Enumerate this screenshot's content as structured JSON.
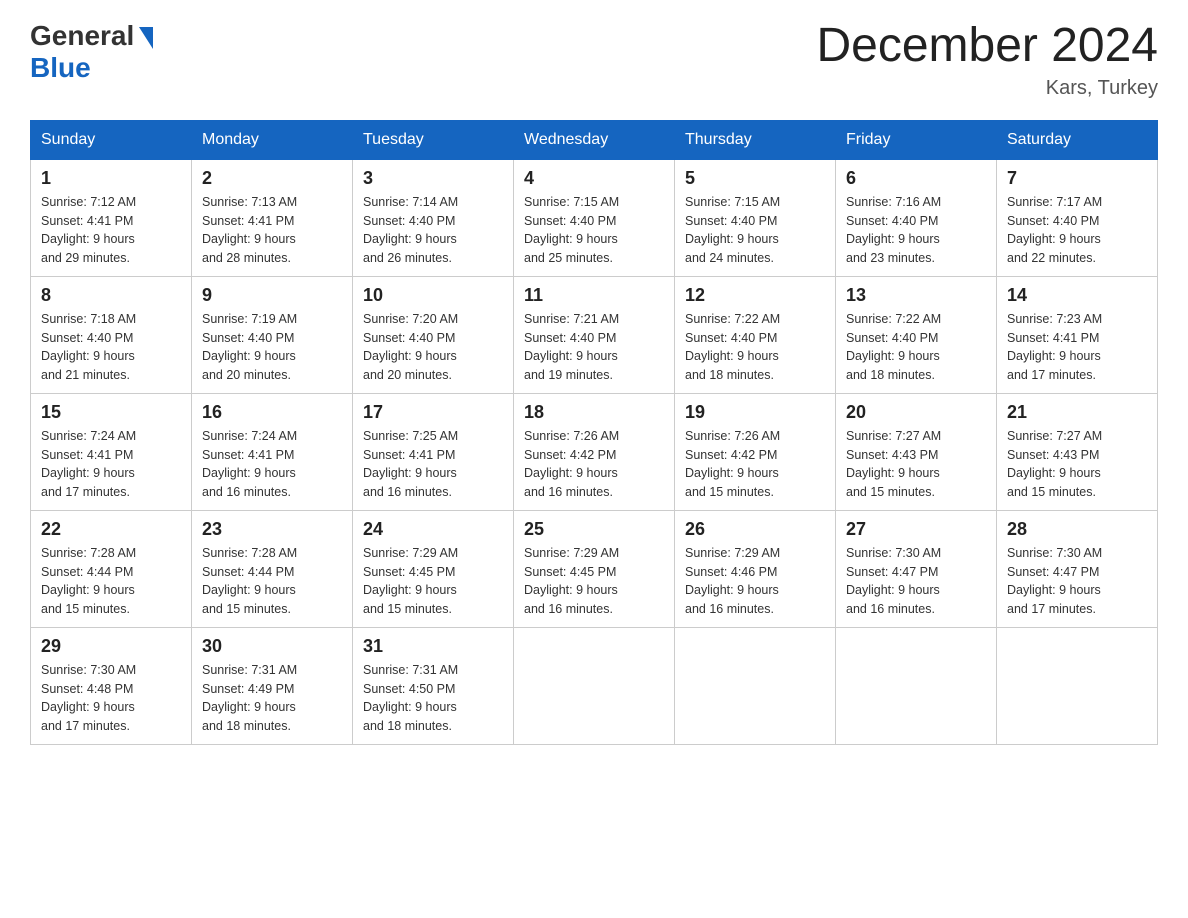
{
  "header": {
    "logo_general": "General",
    "logo_blue": "Blue",
    "month_title": "December 2024",
    "location": "Kars, Turkey"
  },
  "weekdays": [
    "Sunday",
    "Monday",
    "Tuesday",
    "Wednesday",
    "Thursday",
    "Friday",
    "Saturday"
  ],
  "weeks": [
    [
      {
        "day": "1",
        "sunrise": "7:12 AM",
        "sunset": "4:41 PM",
        "daylight": "9 hours and 29 minutes."
      },
      {
        "day": "2",
        "sunrise": "7:13 AM",
        "sunset": "4:41 PM",
        "daylight": "9 hours and 28 minutes."
      },
      {
        "day": "3",
        "sunrise": "7:14 AM",
        "sunset": "4:40 PM",
        "daylight": "9 hours and 26 minutes."
      },
      {
        "day": "4",
        "sunrise": "7:15 AM",
        "sunset": "4:40 PM",
        "daylight": "9 hours and 25 minutes."
      },
      {
        "day": "5",
        "sunrise": "7:15 AM",
        "sunset": "4:40 PM",
        "daylight": "9 hours and 24 minutes."
      },
      {
        "day": "6",
        "sunrise": "7:16 AM",
        "sunset": "4:40 PM",
        "daylight": "9 hours and 23 minutes."
      },
      {
        "day": "7",
        "sunrise": "7:17 AM",
        "sunset": "4:40 PM",
        "daylight": "9 hours and 22 minutes."
      }
    ],
    [
      {
        "day": "8",
        "sunrise": "7:18 AM",
        "sunset": "4:40 PM",
        "daylight": "9 hours and 21 minutes."
      },
      {
        "day": "9",
        "sunrise": "7:19 AM",
        "sunset": "4:40 PM",
        "daylight": "9 hours and 20 minutes."
      },
      {
        "day": "10",
        "sunrise": "7:20 AM",
        "sunset": "4:40 PM",
        "daylight": "9 hours and 20 minutes."
      },
      {
        "day": "11",
        "sunrise": "7:21 AM",
        "sunset": "4:40 PM",
        "daylight": "9 hours and 19 minutes."
      },
      {
        "day": "12",
        "sunrise": "7:22 AM",
        "sunset": "4:40 PM",
        "daylight": "9 hours and 18 minutes."
      },
      {
        "day": "13",
        "sunrise": "7:22 AM",
        "sunset": "4:40 PM",
        "daylight": "9 hours and 18 minutes."
      },
      {
        "day": "14",
        "sunrise": "7:23 AM",
        "sunset": "4:41 PM",
        "daylight": "9 hours and 17 minutes."
      }
    ],
    [
      {
        "day": "15",
        "sunrise": "7:24 AM",
        "sunset": "4:41 PM",
        "daylight": "9 hours and 17 minutes."
      },
      {
        "day": "16",
        "sunrise": "7:24 AM",
        "sunset": "4:41 PM",
        "daylight": "9 hours and 16 minutes."
      },
      {
        "day": "17",
        "sunrise": "7:25 AM",
        "sunset": "4:41 PM",
        "daylight": "9 hours and 16 minutes."
      },
      {
        "day": "18",
        "sunrise": "7:26 AM",
        "sunset": "4:42 PM",
        "daylight": "9 hours and 16 minutes."
      },
      {
        "day": "19",
        "sunrise": "7:26 AM",
        "sunset": "4:42 PM",
        "daylight": "9 hours and 15 minutes."
      },
      {
        "day": "20",
        "sunrise": "7:27 AM",
        "sunset": "4:43 PM",
        "daylight": "9 hours and 15 minutes."
      },
      {
        "day": "21",
        "sunrise": "7:27 AM",
        "sunset": "4:43 PM",
        "daylight": "9 hours and 15 minutes."
      }
    ],
    [
      {
        "day": "22",
        "sunrise": "7:28 AM",
        "sunset": "4:44 PM",
        "daylight": "9 hours and 15 minutes."
      },
      {
        "day": "23",
        "sunrise": "7:28 AM",
        "sunset": "4:44 PM",
        "daylight": "9 hours and 15 minutes."
      },
      {
        "day": "24",
        "sunrise": "7:29 AM",
        "sunset": "4:45 PM",
        "daylight": "9 hours and 15 minutes."
      },
      {
        "day": "25",
        "sunrise": "7:29 AM",
        "sunset": "4:45 PM",
        "daylight": "9 hours and 16 minutes."
      },
      {
        "day": "26",
        "sunrise": "7:29 AM",
        "sunset": "4:46 PM",
        "daylight": "9 hours and 16 minutes."
      },
      {
        "day": "27",
        "sunrise": "7:30 AM",
        "sunset": "4:47 PM",
        "daylight": "9 hours and 16 minutes."
      },
      {
        "day": "28",
        "sunrise": "7:30 AM",
        "sunset": "4:47 PM",
        "daylight": "9 hours and 17 minutes."
      }
    ],
    [
      {
        "day": "29",
        "sunrise": "7:30 AM",
        "sunset": "4:48 PM",
        "daylight": "9 hours and 17 minutes."
      },
      {
        "day": "30",
        "sunrise": "7:31 AM",
        "sunset": "4:49 PM",
        "daylight": "9 hours and 18 minutes."
      },
      {
        "day": "31",
        "sunrise": "7:31 AM",
        "sunset": "4:50 PM",
        "daylight": "9 hours and 18 minutes."
      },
      null,
      null,
      null,
      null
    ]
  ],
  "labels": {
    "sunrise_prefix": "Sunrise: ",
    "sunset_prefix": "Sunset: ",
    "daylight_prefix": "Daylight: "
  }
}
